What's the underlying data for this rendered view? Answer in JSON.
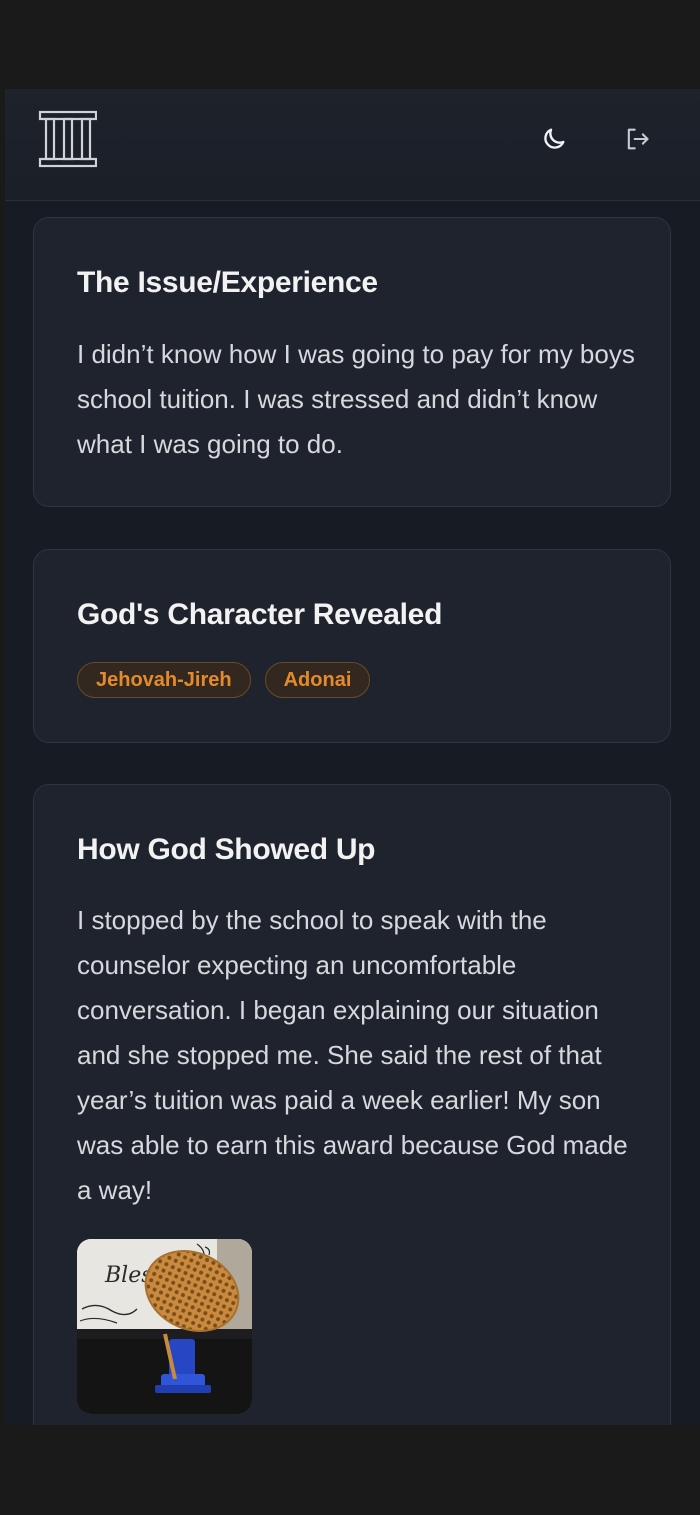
{
  "header": {
    "logo_icon": "columns-building-icon",
    "theme_icon": "moon-icon",
    "logout_icon": "logout-icon"
  },
  "issue": {
    "title": "The Issue/Experience",
    "body": "I didn’t know how I was going to pay for my boys school tuition. I was stressed and didn’t know what I was going to do."
  },
  "character": {
    "title": "God's Character Revealed",
    "tags": [
      "Jehovah-Jireh",
      "Adonai"
    ]
  },
  "showed_up": {
    "title": "How God Showed Up",
    "body": "I stopped by the school to speak with the counselor expecting an uncomfortable conversation. I began explaining our situation and she stopped me. She said the rest of that year’s tuition was paid a week earlier! My son was able to earn this award because God made a way!",
    "photo": {
      "sign_text": "Bles"
    }
  },
  "colors": {
    "background": "#161b24",
    "card": "#1e232d",
    "tag_text": "#e38b2c",
    "tag_border": "#6b4a22"
  }
}
